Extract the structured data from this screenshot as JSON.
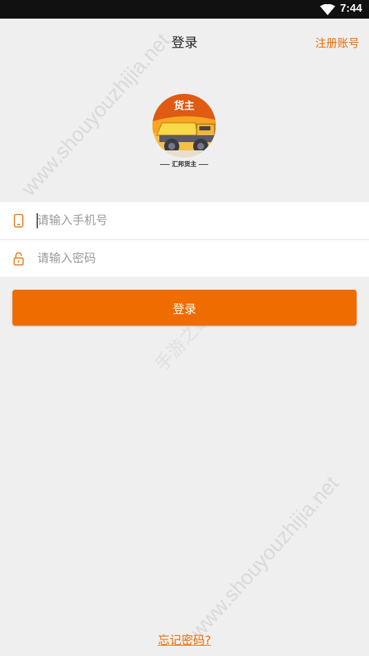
{
  "status_bar": {
    "time": "7:44"
  },
  "nav": {
    "title": "登录",
    "register_label": "注册账号"
  },
  "logo": {
    "badge_text": "货主",
    "caption": "汇邦货主"
  },
  "form": {
    "phone_placeholder": "请输入手机号",
    "password_placeholder": "请输入密码"
  },
  "login_button_label": "登录",
  "forgot_password_label": "忘记密码?",
  "watermarks": [
    "www.shouyouzhijia.net",
    "www.shouyouzhijia.net",
    "手游之家"
  ],
  "icons": {
    "wifi": "wifi-icon",
    "phone": "phone-icon",
    "lock": "lock-icon"
  },
  "colors": {
    "accent": "#ef6c00",
    "background": "#efefef",
    "status_bar": "#111111"
  }
}
